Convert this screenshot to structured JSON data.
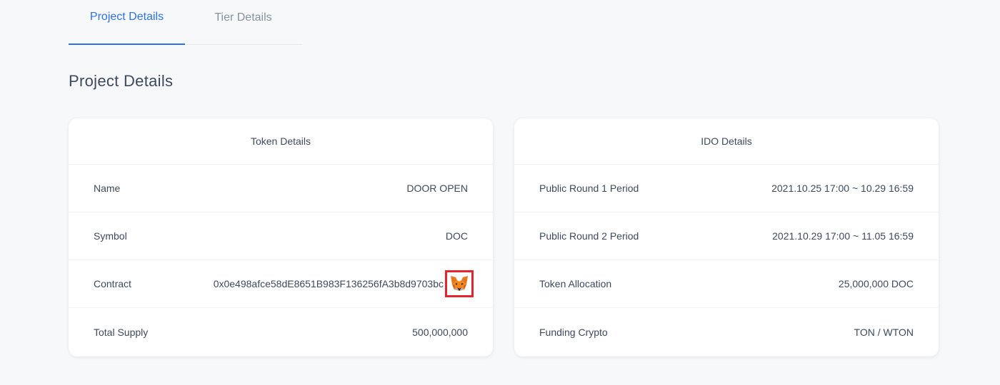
{
  "tabs": [
    {
      "label": "Project Details",
      "active": true
    },
    {
      "label": "Tier Details",
      "active": false
    }
  ],
  "section_title": "Project Details",
  "token_details": {
    "title": "Token Details",
    "rows": [
      {
        "label": "Name",
        "value": "DOOR OPEN"
      },
      {
        "label": "Symbol",
        "value": "DOC"
      },
      {
        "label": "Contract",
        "value": "0x0e498afce58dE8651B983F136256fA3b8d9703bc",
        "action_icon": "metamask-fox-icon"
      },
      {
        "label": "Total Supply",
        "value": "500,000,000"
      }
    ]
  },
  "ido_details": {
    "title": "IDO Details",
    "rows": [
      {
        "label": "Public Round 1 Period",
        "value": "2021.10.25 17:00 ~ 10.29 16:59"
      },
      {
        "label": "Public Round 2 Period",
        "value": "2021.10.29 17:00 ~ 11.05 16:59"
      },
      {
        "label": "Token Allocation",
        "value": "25,000,000 DOC"
      },
      {
        "label": "Funding Crypto",
        "value": "TON / WTON"
      }
    ]
  },
  "colors": {
    "accent": "#2a72e5",
    "highlight_border": "#e3262d",
    "background": "#f7f8fa"
  }
}
